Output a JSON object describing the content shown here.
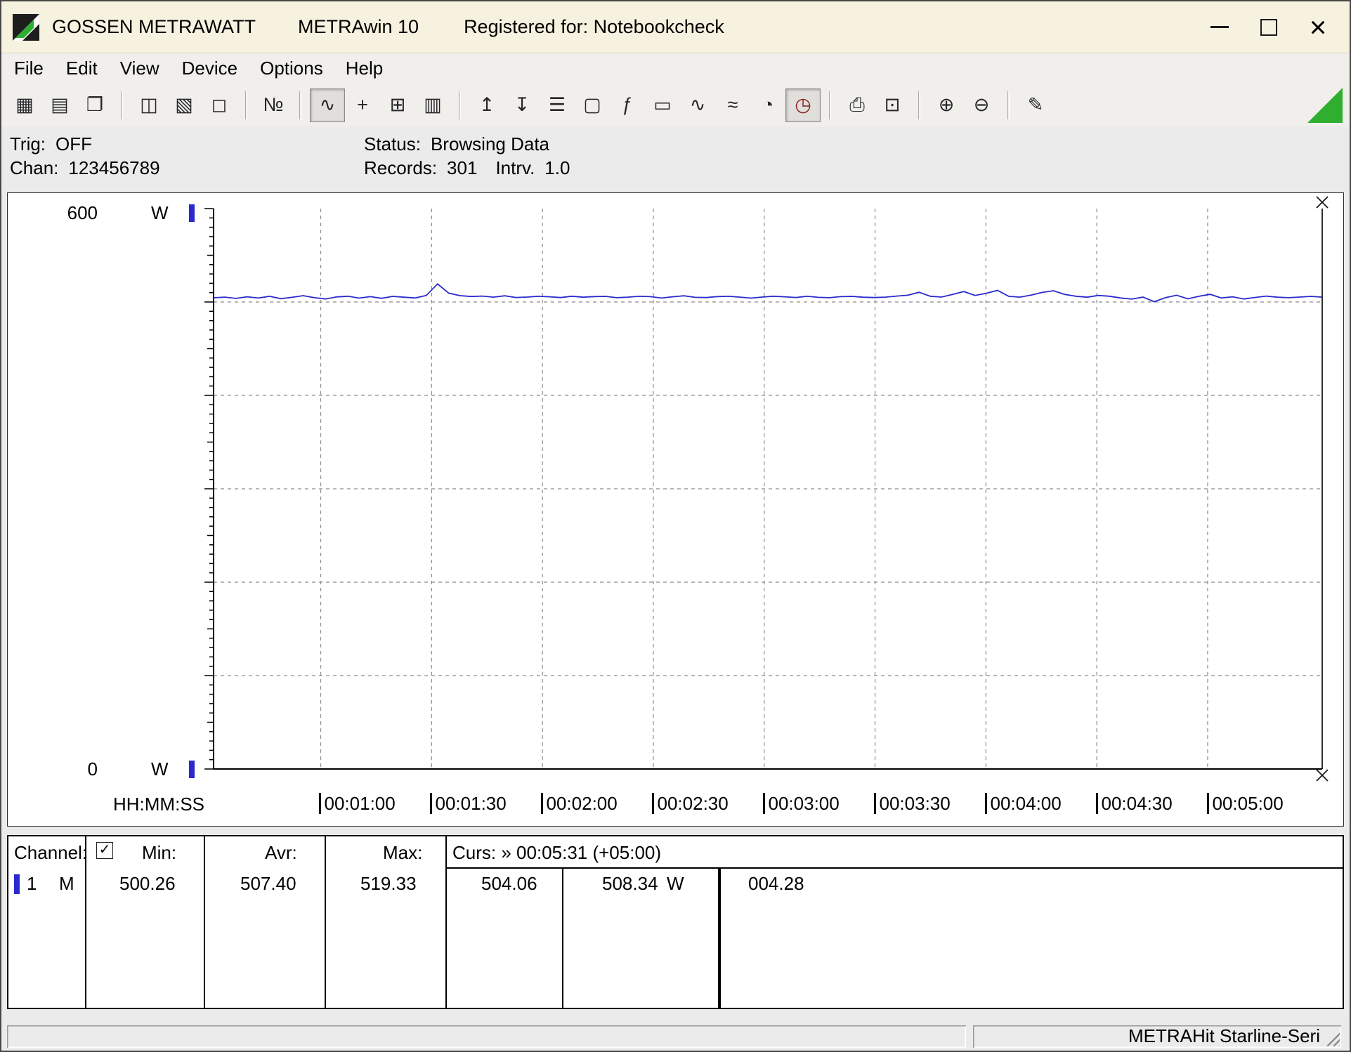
{
  "titlebar": {
    "brand": "GOSSEN METRAWATT",
    "app": "METRAwin 10",
    "registered": "Registered for: Notebookcheck"
  },
  "menu": {
    "items": [
      "File",
      "Edit",
      "View",
      "Device",
      "Options",
      "Help"
    ]
  },
  "toolbar": {
    "buttons": [
      {
        "name": "save",
        "glyph": "▦"
      },
      {
        "name": "save-as",
        "glyph": "▤"
      },
      {
        "name": "open",
        "glyph": "❐"
      },
      {
        "name": "export",
        "glyph": "◫"
      },
      {
        "name": "import",
        "glyph": "▧"
      },
      {
        "name": "copy",
        "glyph": "◻"
      },
      {
        "name": "numeric-display",
        "glyph": "№"
      },
      {
        "name": "trend-view",
        "glyph": "∿"
      },
      {
        "name": "crosshair",
        "glyph": "+"
      },
      {
        "name": "table-view",
        "glyph": "⊞"
      },
      {
        "name": "bar-graph",
        "glyph": "▥"
      },
      {
        "name": "upload",
        "glyph": "↥"
      },
      {
        "name": "download",
        "glyph": "↧"
      },
      {
        "name": "sequence-list",
        "glyph": "☰"
      },
      {
        "name": "monitor",
        "glyph": "▢"
      },
      {
        "name": "function",
        "glyph": "ƒ"
      },
      {
        "name": "device-display",
        "glyph": "▭"
      },
      {
        "name": "waveform",
        "glyph": "∿"
      },
      {
        "name": "envelope",
        "glyph": "≈"
      },
      {
        "name": "clock",
        "glyph": "◔"
      },
      {
        "name": "timer",
        "glyph": "◷"
      },
      {
        "name": "print",
        "glyph": "⎙"
      },
      {
        "name": "print-preview",
        "glyph": "⊡"
      },
      {
        "name": "zoom-in",
        "glyph": "⊕"
      },
      {
        "name": "zoom-out",
        "glyph": "⊖"
      },
      {
        "name": "comment",
        "glyph": "✎"
      }
    ]
  },
  "status_panel": {
    "trig_label": "Trig:",
    "trig_value": "OFF",
    "chan_label": "Chan:",
    "chan_value": "123456789",
    "status_label": "Status:",
    "status_value": "Browsing Data",
    "records_label": "Records:",
    "records_value": "301",
    "intrv_label": "Intrv.",
    "intrv_value": "1.0"
  },
  "chart": {
    "y_max_label": "600",
    "y_min_label": "0",
    "y_unit": "W",
    "x_axis_label": "HH:MM:SS"
  },
  "chart_data": {
    "type": "line",
    "ylabel": "W",
    "ylim": [
      0,
      600
    ],
    "y_gridline_step": 100,
    "x_start_s": 31,
    "x_end_s": 331,
    "sample_step_s": 3.0303,
    "x_gridlines_s": [
      60,
      90,
      120,
      150,
      180,
      210,
      240,
      270,
      300
    ],
    "x_tick_labels": [
      "00:01:00",
      "00:01:30",
      "00:02:00",
      "00:02:30",
      "00:03:00",
      "00:03:30",
      "00:04:00",
      "00:04:30",
      "00:05:00"
    ],
    "cursor": {
      "time_s": 331,
      "label": "00:05:31",
      "offset_label": "(+05:00)"
    },
    "series": [
      {
        "name": "Channel 1",
        "unit": "W",
        "color": "#2a2ace",
        "min": 500.26,
        "avg": 507.4,
        "max": 519.33,
        "values": [
          504.5,
          505.2,
          503.8,
          505.6,
          504.2,
          506.1,
          503.5,
          505.0,
          506.8,
          504.6,
          503.2,
          505.4,
          506.2,
          504.1,
          505.7,
          503.9,
          506.0,
          505.1,
          504.3,
          507.0,
          519.3,
          509.5,
          506.8,
          505.9,
          506.3,
          505.2,
          506.6,
          504.8,
          505.3,
          506.1,
          505.6,
          504.7,
          506.2,
          505.1,
          505.8,
          506.0,
          504.6,
          505.2,
          506.1,
          505.7,
          504.2,
          505.6,
          506.6,
          505.0,
          504.7,
          505.8,
          506.1,
          505.2,
          504.1,
          505.3,
          506.2,
          505.6,
          504.8,
          506.1,
          505.0,
          504.6,
          505.7,
          506.0,
          505.1,
          504.7,
          505.2,
          506.3,
          507.2,
          510.4,
          506.2,
          505.3,
          508.1,
          511.2,
          507.0,
          509.3,
          512.4,
          506.1,
          505.2,
          507.3,
          510.2,
          512.0,
          508.1,
          506.2,
          505.1,
          507.0,
          506.2,
          504.3,
          503.1,
          505.2,
          500.3,
          504.6,
          507.2,
          503.4,
          506.1,
          508.2,
          504.3,
          505.6,
          503.2,
          504.8,
          506.3,
          505.1,
          504.6,
          505.3,
          506.0,
          505.2
        ]
      }
    ]
  },
  "table": {
    "header": {
      "channel": "Channel:",
      "checkbox_glyph": "✓",
      "min": "Min:",
      "avr": "Avr:",
      "max": "Max:",
      "curs": "Curs: » 00:05:31 (+05:00)"
    },
    "row": {
      "channel": "1",
      "mode": "M",
      "min": "500.26",
      "avr": "507.40",
      "max": "519.33",
      "curs_value_1": "504.06",
      "curs_value_2": "508.34",
      "unit": "W",
      "delta": "004.28"
    }
  },
  "statusbar": {
    "device": "METRAHit Starline-Seri"
  }
}
